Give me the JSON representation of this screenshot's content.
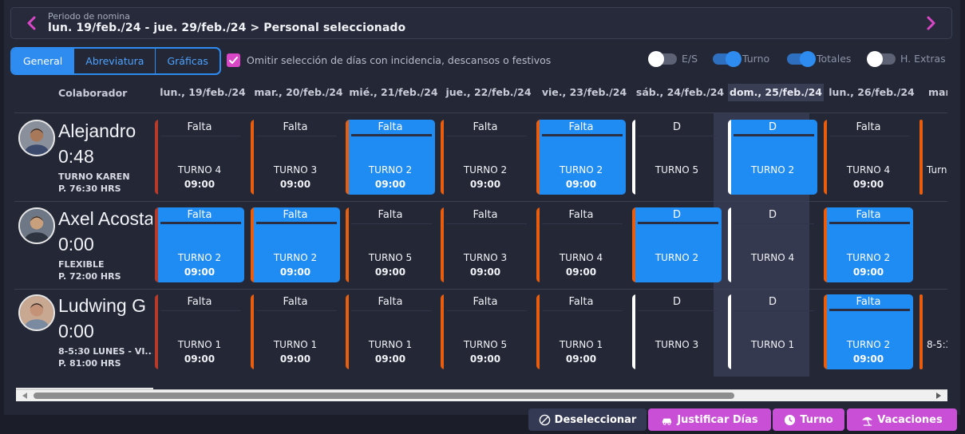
{
  "period": {
    "label": "Periodo de nomina",
    "range": "lun. 19/feb./24 - jue. 29/feb./24 > Personal seleccionado",
    "prev_icon": "chevron-left-icon",
    "next_icon": "chevron-right-icon"
  },
  "view_tabs": [
    {
      "label": "General",
      "active": true
    },
    {
      "label": "Abreviatura",
      "active": false
    },
    {
      "label": "Gráficas",
      "active": false
    }
  ],
  "omit_option": {
    "label": "Omitir selección de días con incidencia, descansos o festivos",
    "checked": true
  },
  "toggles": [
    {
      "label": "E/S",
      "on": false
    },
    {
      "label": "Turno",
      "on": true
    },
    {
      "label": "Totales",
      "on": true
    },
    {
      "label": "H. Extras",
      "on": false
    }
  ],
  "columns": {
    "collaborator": "Colaborador",
    "days": [
      "lun., 19/feb./24",
      "mar., 20/feb./24",
      "mié., 21/feb./24",
      "jue., 22/feb./24",
      "vie., 23/feb./24",
      "sáb., 24/feb./24",
      "dom., 25/feb./24",
      "lun., 26/feb./24",
      "mar"
    ],
    "highlighted_day_index": 6
  },
  "employees": [
    {
      "name": "Alejandro",
      "hours": "0:48",
      "shift": "TURNO KAREN",
      "planned": "P. 76:30 HRS",
      "days": [
        {
          "incidence": "Falta",
          "shift": "TURNO 4",
          "time": "09:00",
          "selected": false,
          "edge": "#b83a28"
        },
        {
          "incidence": "Falta",
          "shift": "TURNO 3",
          "time": "09:00",
          "selected": false,
          "edge": "#e85d0e"
        },
        {
          "incidence": "Falta",
          "shift": "TURNO 2",
          "time": "09:00",
          "selected": true,
          "edge": "#e85d0e"
        },
        {
          "incidence": "Falta",
          "shift": "TURNO 2",
          "time": "09:00",
          "selected": false,
          "edge": "#e85d0e"
        },
        {
          "incidence": "Falta",
          "shift": "TURNO 2",
          "time": "09:00",
          "selected": true,
          "edge": "#e85d0e"
        },
        {
          "incidence": "D",
          "shift": "TURNO 5",
          "time": "",
          "selected": false,
          "edge": "#ffffff"
        },
        {
          "incidence": "D",
          "shift": "TURNO 2",
          "time": "",
          "selected": true,
          "edge": "#ffffff"
        },
        {
          "incidence": "Falta",
          "shift": "TURNO 4",
          "time": "09:00",
          "selected": false,
          "edge": "#e85d0e"
        }
      ],
      "overflow": {
        "text": "Turno",
        "edge": "#e85d0e"
      }
    },
    {
      "name": "Axel Acosta",
      "hours": "0:00",
      "shift": "FLEXIBLE",
      "planned": "P. 72:00 HRS",
      "days": [
        {
          "incidence": "Falta",
          "shift": "TURNO 2",
          "time": "09:00",
          "selected": true,
          "edge": "#b83a28"
        },
        {
          "incidence": "Falta",
          "shift": "TURNO 2",
          "time": "09:00",
          "selected": true,
          "edge": "#e85d0e"
        },
        {
          "incidence": "Falta",
          "shift": "TURNO 5",
          "time": "09:00",
          "selected": false,
          "edge": "#e85d0e"
        },
        {
          "incidence": "Falta",
          "shift": "TURNO 3",
          "time": "09:00",
          "selected": false,
          "edge": "#e85d0e"
        },
        {
          "incidence": "Falta",
          "shift": "TURNO 4",
          "time": "09:00",
          "selected": false,
          "edge": "#e85d0e"
        },
        {
          "incidence": "D",
          "shift": "TURNO 2",
          "time": "",
          "selected": true,
          "edge": "#e85d0e"
        },
        {
          "incidence": "D",
          "shift": "TURNO 4",
          "time": "",
          "selected": false,
          "edge": "#ffffff"
        },
        {
          "incidence": "Falta",
          "shift": "TURNO 2",
          "time": "09:00",
          "selected": true,
          "edge": "#e85d0e"
        }
      ],
      "overflow": {
        "text": "",
        "edge": ""
      }
    },
    {
      "name": "Ludwing G",
      "hours": "0:00",
      "shift": "8-5:30 LUNES - VI...",
      "planned": "P. 81:00 HRS",
      "days": [
        {
          "incidence": "Falta",
          "shift": "TURNO 1",
          "time": "09:00",
          "selected": false,
          "edge": "#b83a28"
        },
        {
          "incidence": "Falta",
          "shift": "TURNO 1",
          "time": "09:00",
          "selected": false,
          "edge": "#e85d0e"
        },
        {
          "incidence": "Falta",
          "shift": "TURNO 1",
          "time": "09:00",
          "selected": false,
          "edge": "#e85d0e"
        },
        {
          "incidence": "Falta",
          "shift": "TURNO 5",
          "time": "09:00",
          "selected": false,
          "edge": "#e85d0e"
        },
        {
          "incidence": "Falta",
          "shift": "TURNO 1",
          "time": "09:00",
          "selected": false,
          "edge": "#e85d0e"
        },
        {
          "incidence": "D",
          "shift": "TURNO 3",
          "time": "",
          "selected": false,
          "edge": "#ffffff"
        },
        {
          "incidence": "D",
          "shift": "TURNO 1",
          "time": "",
          "selected": false,
          "edge": "#ffffff"
        },
        {
          "incidence": "Falta",
          "shift": "TURNO 2",
          "time": "09:00",
          "selected": true,
          "edge": "#e85d0e"
        }
      ],
      "overflow": {
        "text": "8-5:3",
        "edge": "#e85d0e"
      }
    }
  ],
  "actions": [
    {
      "label": "Deseleccionar",
      "icon": "deselect-icon",
      "style": "dark"
    },
    {
      "label": "Justificar Días",
      "icon": "car-icon",
      "style": "pink"
    },
    {
      "label": "Turno",
      "icon": "clock-icon",
      "style": "pink"
    },
    {
      "label": "Vacaciones",
      "icon": "beach-umbrella-icon",
      "style": "pink"
    }
  ],
  "colors": {
    "accent_blue": "#1f8cf4",
    "accent_pink": "#c94fd6",
    "absence_orange": "#e85d0e",
    "background": "#232736"
  }
}
